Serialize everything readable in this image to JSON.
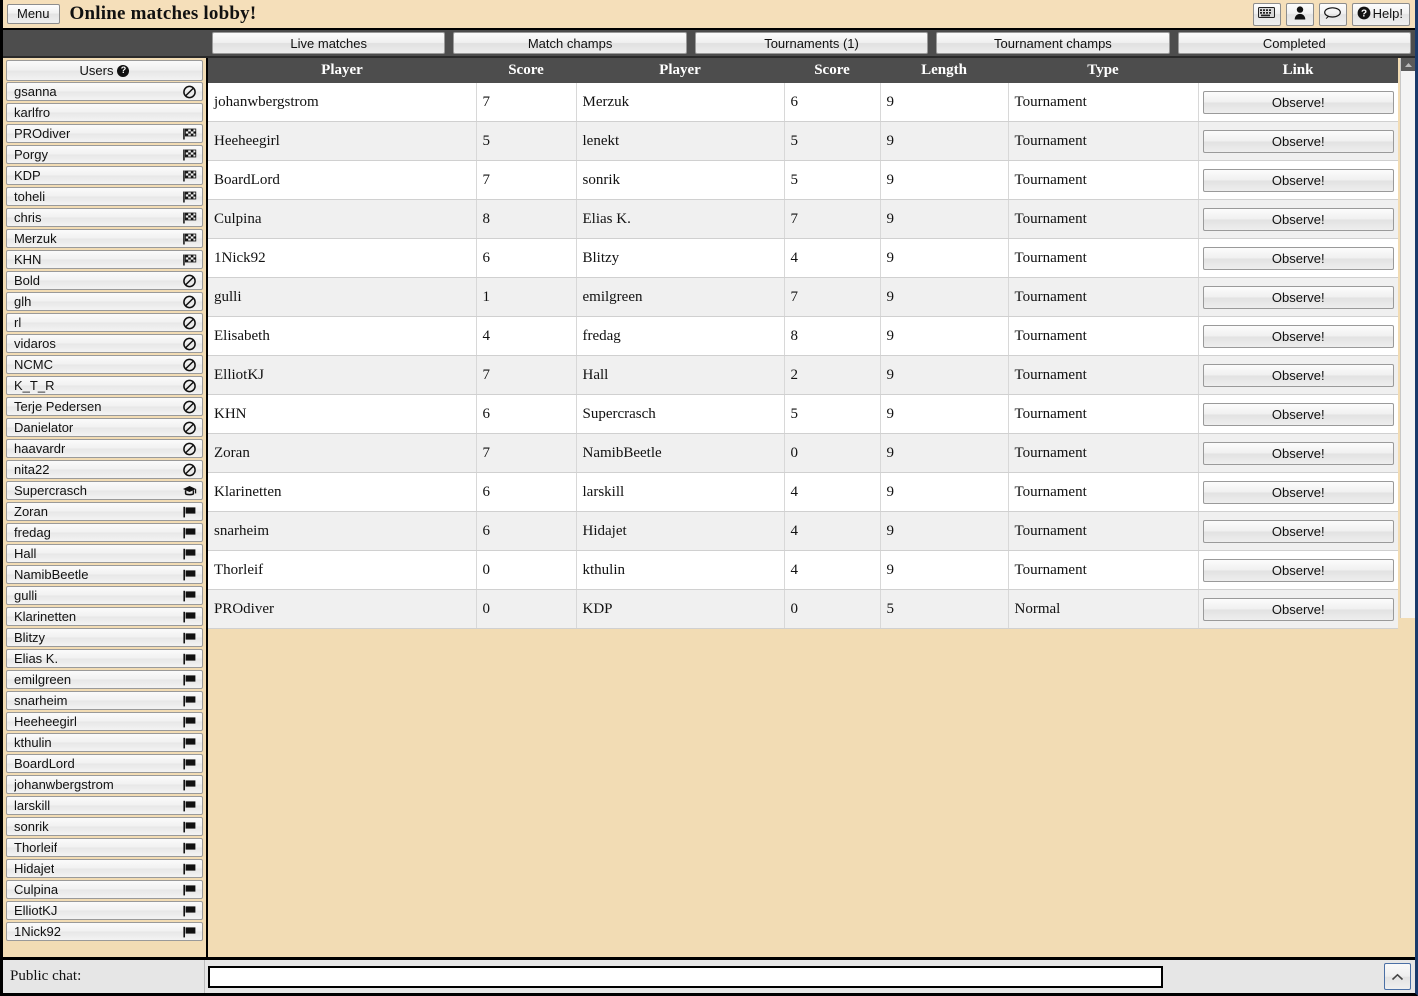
{
  "titlebar": {
    "menu_label": "Menu",
    "app_title": "Online matches lobby!",
    "keyboard_icon": "keyboard-icon",
    "user_icon": "person-icon",
    "chat_icon": "speech-bubble-icon",
    "help_label": "Help!"
  },
  "tabs": [
    {
      "label": "Live matches"
    },
    {
      "label": "Match champs"
    },
    {
      "label": "Tournaments (1)"
    },
    {
      "label": "Tournament champs"
    },
    {
      "label": "Completed"
    }
  ],
  "sidebar": {
    "header": "Users",
    "help_glyph": "?",
    "users": [
      {
        "name": "gsanna",
        "status": "busy"
      },
      {
        "name": "karlfro",
        "status": "none"
      },
      {
        "name": "PROdiver",
        "status": "checkered"
      },
      {
        "name": "Porgy",
        "status": "checkered"
      },
      {
        "name": "KDP",
        "status": "checkered"
      },
      {
        "name": "toheli",
        "status": "checkered"
      },
      {
        "name": "chris",
        "status": "checkered"
      },
      {
        "name": "Merzuk",
        "status": "checkered"
      },
      {
        "name": "KHN",
        "status": "checkered"
      },
      {
        "name": "Bold",
        "status": "busy"
      },
      {
        "name": "glh",
        "status": "busy"
      },
      {
        "name": "rl",
        "status": "busy"
      },
      {
        "name": "vidaros",
        "status": "busy"
      },
      {
        "name": "NCMC",
        "status": "busy"
      },
      {
        "name": "K_T_R",
        "status": "busy"
      },
      {
        "name": "Terje Pedersen",
        "status": "busy"
      },
      {
        "name": "Danielator",
        "status": "busy"
      },
      {
        "name": "haavardr",
        "status": "busy"
      },
      {
        "name": "nita22",
        "status": "busy"
      },
      {
        "name": "Supercrasch",
        "status": "graduate"
      },
      {
        "name": "Zoran",
        "status": "flag"
      },
      {
        "name": "fredag",
        "status": "flag"
      },
      {
        "name": "Hall",
        "status": "flag"
      },
      {
        "name": "NamibBeetle",
        "status": "flag"
      },
      {
        "name": "gulli",
        "status": "flag"
      },
      {
        "name": "Klarinetten",
        "status": "flag"
      },
      {
        "name": "Blitzy",
        "status": "flag"
      },
      {
        "name": "Elias K.",
        "status": "flag"
      },
      {
        "name": "emilgreen",
        "status": "flag"
      },
      {
        "name": "snarheim",
        "status": "flag"
      },
      {
        "name": "Heeheegirl",
        "status": "flag"
      },
      {
        "name": "kthulin",
        "status": "flag"
      },
      {
        "name": "BoardLord",
        "status": "flag"
      },
      {
        "name": "johanwbergstrom",
        "status": "flag"
      },
      {
        "name": "larskill",
        "status": "flag"
      },
      {
        "name": "sonrik",
        "status": "flag"
      },
      {
        "name": "Thorleif",
        "status": "flag"
      },
      {
        "name": "Hidajet",
        "status": "flag"
      },
      {
        "name": "Culpina",
        "status": "flag"
      },
      {
        "name": "ElliotKJ",
        "status": "flag"
      },
      {
        "name": "1Nick92",
        "status": "flag"
      }
    ]
  },
  "matches_table": {
    "columns": [
      "Player",
      "Score",
      "Player",
      "Score",
      "Length",
      "Type",
      "Link"
    ],
    "observe_label": "Observe!",
    "rows": [
      {
        "player1": "johanwbergstrom",
        "score1": "7",
        "player2": "Merzuk",
        "score2": "6",
        "length": "9",
        "type": "Tournament"
      },
      {
        "player1": "Heeheegirl",
        "score1": "5",
        "player2": "lenekt",
        "score2": "5",
        "length": "9",
        "type": "Tournament"
      },
      {
        "player1": "BoardLord",
        "score1": "7",
        "player2": "sonrik",
        "score2": "5",
        "length": "9",
        "type": "Tournament"
      },
      {
        "player1": "Culpina",
        "score1": "8",
        "player2": "Elias K.",
        "score2": "7",
        "length": "9",
        "type": "Tournament"
      },
      {
        "player1": "1Nick92",
        "score1": "6",
        "player2": "Blitzy",
        "score2": "4",
        "length": "9",
        "type": "Tournament"
      },
      {
        "player1": "gulli",
        "score1": "1",
        "player2": "emilgreen",
        "score2": "7",
        "length": "9",
        "type": "Tournament"
      },
      {
        "player1": "Elisabeth",
        "score1": "4",
        "player2": "fredag",
        "score2": "8",
        "length": "9",
        "type": "Tournament"
      },
      {
        "player1": "ElliotKJ",
        "score1": "7",
        "player2": "Hall",
        "score2": "2",
        "length": "9",
        "type": "Tournament"
      },
      {
        "player1": "KHN",
        "score1": "6",
        "player2": "Supercrasch",
        "score2": "5",
        "length": "9",
        "type": "Tournament"
      },
      {
        "player1": "Zoran",
        "score1": "7",
        "player2": "NamibBeetle",
        "score2": "0",
        "length": "9",
        "type": "Tournament"
      },
      {
        "player1": "Klarinetten",
        "score1": "6",
        "player2": "larskill",
        "score2": "4",
        "length": "9",
        "type": "Tournament"
      },
      {
        "player1": "snarheim",
        "score1": "6",
        "player2": "Hidajet",
        "score2": "4",
        "length": "9",
        "type": "Tournament"
      },
      {
        "player1": "Thorleif",
        "score1": "0",
        "player2": "kthulin",
        "score2": "4",
        "length": "9",
        "type": "Tournament"
      },
      {
        "player1": "PROdiver",
        "score1": "0",
        "player2": "KDP",
        "score2": "0",
        "length": "5",
        "type": "Normal"
      }
    ]
  },
  "chat": {
    "label": "Public chat:",
    "value": "",
    "placeholder": "",
    "send_icon": "chevron-up-icon"
  },
  "colors": {
    "page_bg": "#f2dcb4",
    "tabbar_bg": "#4d4d4d",
    "header_bg": "#4d4d4d",
    "row_odd": "#ffffff",
    "row_even": "#f0f0f0"
  }
}
